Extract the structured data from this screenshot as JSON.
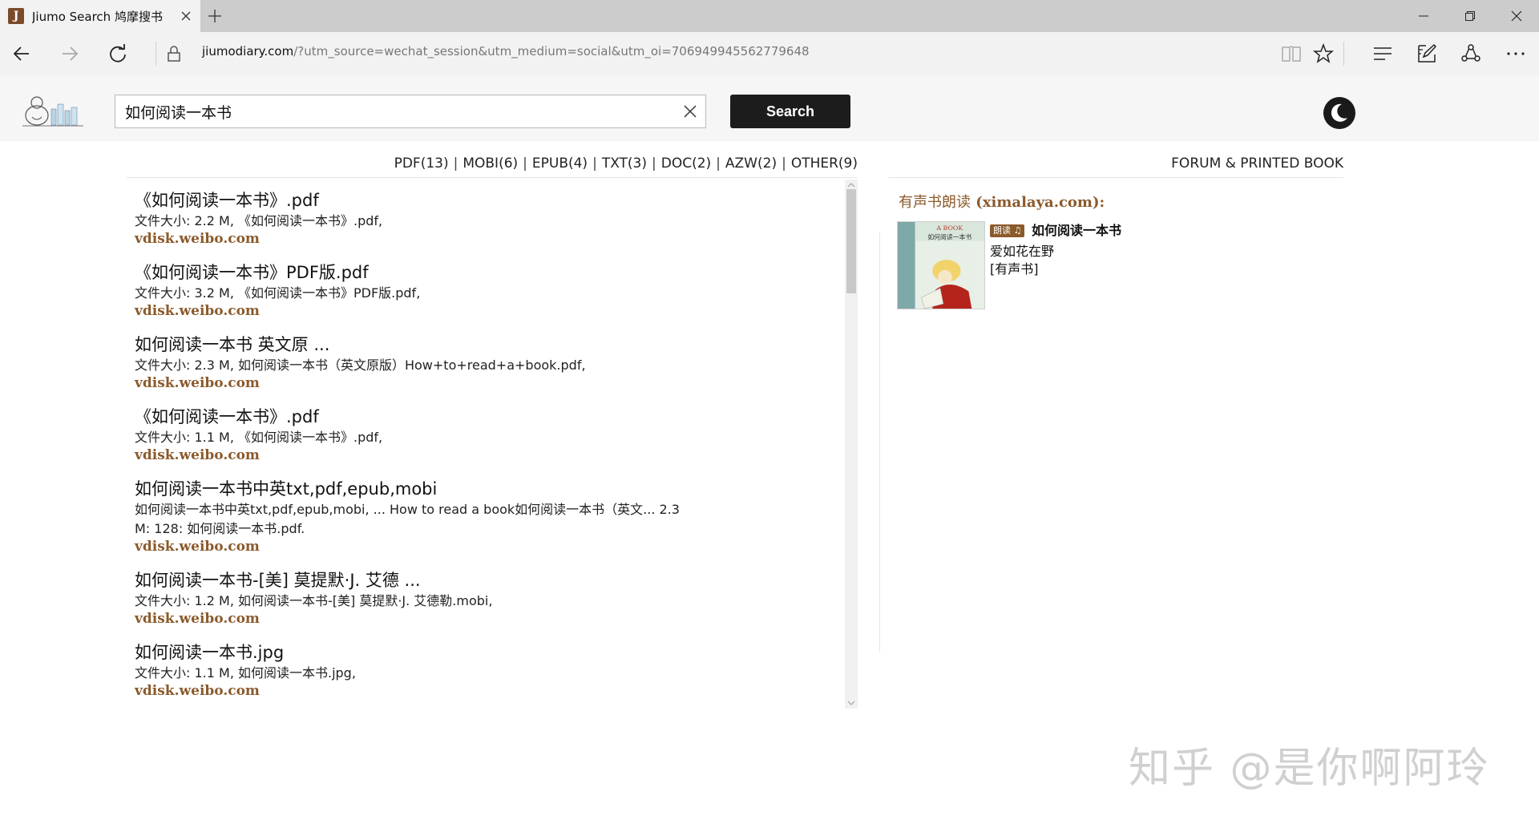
{
  "browser": {
    "tab_title": "Jiumo Search 鸠摩搜书",
    "tab_favicon": "J",
    "url_host": "jiumodiary.com",
    "url_path": "/?utm_source=wechat_session&utm_medium=social&utm_oi=706949945562779648",
    "icons": [
      "close-icon",
      "plus-icon",
      "minimize-icon",
      "restore-icon",
      "window-close-icon",
      "back-arrow-icon",
      "forward-arrow-icon",
      "refresh-icon",
      "lock-icon",
      "reading-view-icon",
      "star-icon",
      "hub-icon",
      "web-note-icon",
      "share-icon",
      "more-icon"
    ]
  },
  "header": {
    "search_value": "如何阅读一本书",
    "search_button": "Search",
    "icons": [
      "site-logo",
      "clear-icon",
      "night-mode-icon"
    ]
  },
  "formats": [
    {
      "label": "PDF(13)"
    },
    {
      "label": "MOBI(6)"
    },
    {
      "label": "EPUB(4)"
    },
    {
      "label": "TXT(3)"
    },
    {
      "label": "DOC(2)"
    },
    {
      "label": "AZW(2)"
    },
    {
      "label": "OTHER(9)"
    }
  ],
  "format_separator": "|",
  "results": [
    {
      "title": "《如何阅读一本书》.pdf",
      "desc": "文件大小: 2.2 M, 《如何阅读一本书》.pdf,",
      "source": "vdisk.weibo.com"
    },
    {
      "title": "《如何阅读一本书》PDF版.pdf",
      "desc": "文件大小: 3.2 M, 《如何阅读一本书》PDF版.pdf,",
      "source": "vdisk.weibo.com"
    },
    {
      "title": "如何阅读一本书 英文原 ...",
      "desc": "文件大小: 2.3 M, 如何阅读一本书（英文原版）How+to+read+a+book.pdf,",
      "source": "vdisk.weibo.com"
    },
    {
      "title": "《如何阅读一本书》.pdf",
      "desc": "文件大小: 1.1 M, 《如何阅读一本书》.pdf,",
      "source": "vdisk.weibo.com"
    },
    {
      "title": "如何阅读一本书中英txt,pdf,epub,mobi",
      "desc": "如何阅读一本书中英txt,pdf,epub,mobi, ... How to read a book如何阅读一本书（英文... 2.3",
      "desc2": "M: 128: 如何阅读一本书.pdf.",
      "source": "vdisk.weibo.com"
    },
    {
      "title": "如何阅读一本书-[美] 莫提默·J. 艾德 ...",
      "desc": "文件大小: 1.2 M, 如何阅读一本书-[美] 莫提默·J. 艾德勒.mobi,",
      "source": "vdisk.weibo.com"
    },
    {
      "title": "如何阅读一本书.jpg",
      "desc": "文件大小: 1.1 M, 如何阅读一本书.jpg,",
      "source": "vdisk.weibo.com"
    }
  ],
  "right_panel": {
    "forum_link": "FORUM & PRINTED BOOK",
    "audio_heading_cn": "有声书朗读",
    "audio_heading_site": "(ximalaya.com):",
    "badge": "朗读",
    "audiobook_title": "如何阅读一本书",
    "audiobook_author": "爱如花在野",
    "audiobook_publisher": "[有声书]",
    "cover_top_text": "A BOOK",
    "cover_title": "如何阅读一本书"
  },
  "watermark": "知乎 @是你啊阿玲",
  "colors": {
    "source": "#8b5a2b",
    "accent_badge": "#8b5a2b",
    "search_button": "#1c1c1c"
  }
}
